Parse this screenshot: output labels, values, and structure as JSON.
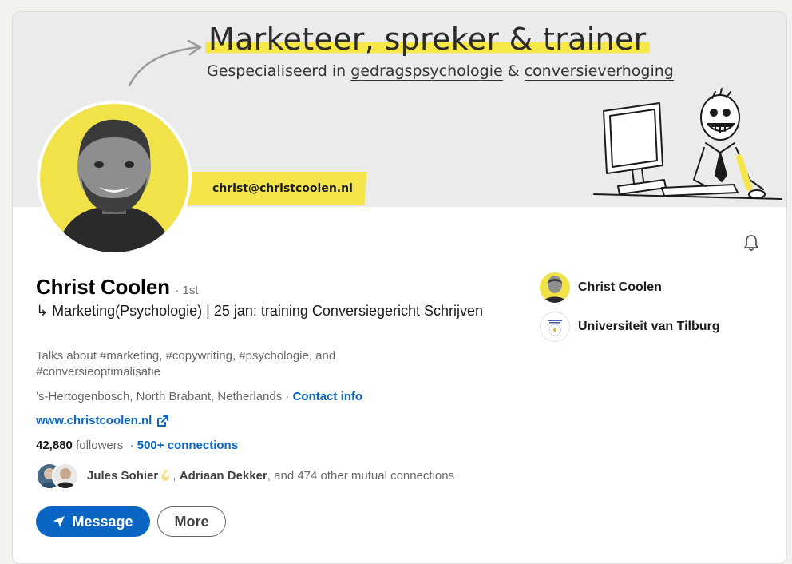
{
  "banner": {
    "headline": "Marketeer, spreker & trainer",
    "subheadline_prefix": "Gespecialiseerd in ",
    "subheadline_term1": "gedragspsychologie",
    "subheadline_amp": " & ",
    "subheadline_term2": "conversieverhoging",
    "email": "christ@christcoolen.nl",
    "accent_color": "#f5e54a"
  },
  "profile": {
    "name": "Christ Coolen",
    "degree": "· 1st",
    "headline": "↳ Marketing(Psychologie) | 25 jan: training Conversiegericht Schrijven",
    "talks_about": "Talks about #marketing, #copywriting, #psychologie, and #conversieoptimalisatie",
    "location": "’s-Hertogenbosch, North Brabant, Netherlands · ",
    "contact_info": "Contact info",
    "website": "www.christcoolen.nl",
    "followers_count": "42,880",
    "followers_label": " followers  · ",
    "connections": "500+ connections",
    "mutual_name1": "Jules Sohier",
    "mutual_sep": ", ",
    "mutual_name2": "Adriaan Dekker",
    "mutual_rest": ", and 474 other mutual connections"
  },
  "actions": {
    "message_label": "Message",
    "more_label": "More"
  },
  "right_column": {
    "company": "Christ Coolen",
    "school": "Universiteit van Tilburg"
  },
  "icons": {
    "bell": "bell-icon",
    "message": "send-icon",
    "external": "external-link-icon"
  },
  "colors": {
    "link_blue": "#0a66c2",
    "banner_bg": "#ebebeb"
  }
}
